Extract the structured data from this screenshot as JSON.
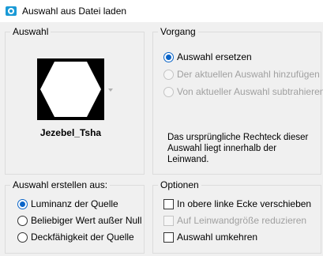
{
  "window": {
    "title": "Auswahl aus Datei laden",
    "icon": "paint-shop-icon"
  },
  "auswahl_group": {
    "legend": "Auswahl",
    "preset_name": "Jezebel_Tsha",
    "thumbnail_icon": "hexagon-shape-icon"
  },
  "vorgang_group": {
    "legend": "Vorgang",
    "options": [
      {
        "label": "Auswahl ersetzen",
        "selected": true,
        "enabled": true
      },
      {
        "label": "Der aktuellen Auswahl hinzufügen",
        "selected": false,
        "enabled": false
      },
      {
        "label": "Von aktueller Auswahl subtrahieren",
        "selected": false,
        "enabled": false
      }
    ],
    "info": "Das ursprüngliche Rechteck dieser Auswahl liegt innerhalb der Leinwand."
  },
  "erstellen_group": {
    "legend": "Auswahl erstellen aus:",
    "options": [
      {
        "label": "Luminanz der Quelle",
        "selected": true
      },
      {
        "label": "Beliebiger Wert außer Null",
        "selected": false
      },
      {
        "label": "Deckfähigkeit der Quelle",
        "selected": false
      }
    ]
  },
  "optionen_group": {
    "legend": "Optionen",
    "options": [
      {
        "label": "In obere linke Ecke verschieben",
        "checked": false,
        "enabled": true
      },
      {
        "label": "Auf Leinwandgröße reduzieren",
        "checked": false,
        "enabled": false
      },
      {
        "label": "Auswahl umkehren",
        "checked": false,
        "enabled": true
      }
    ]
  },
  "colors": {
    "accent": "#0a64c8",
    "background": "#f0f0f0",
    "disabled_text": "#a0a0a0"
  }
}
